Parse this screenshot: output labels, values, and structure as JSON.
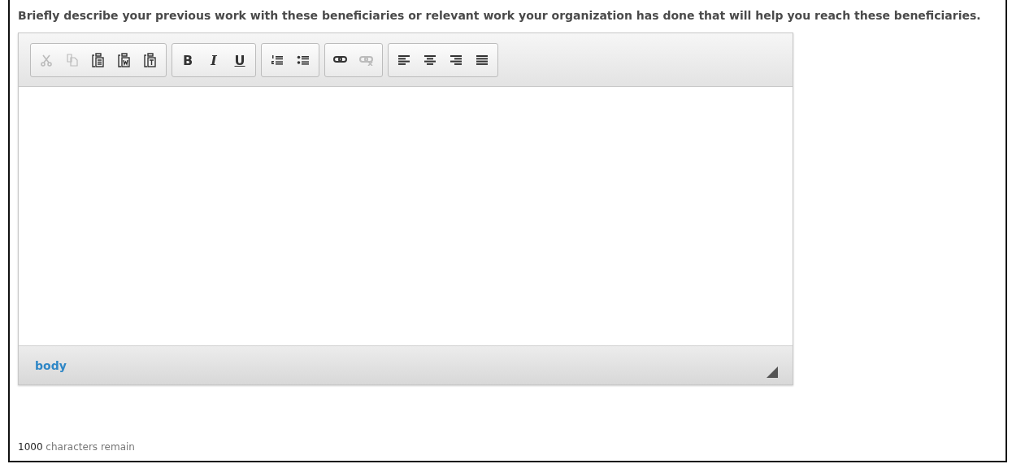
{
  "question": "Briefly describe your previous work with these beneficiaries or relevant work your organization has done that will help you reach these beneficiaries.",
  "toolbar": [
    {
      "items": [
        {
          "kind": "cut",
          "disabled": true
        },
        {
          "kind": "copy",
          "disabled": true
        },
        {
          "kind": "paste",
          "disabled": false
        },
        {
          "kind": "paste-word",
          "disabled": false
        },
        {
          "kind": "paste-text",
          "disabled": false
        }
      ]
    },
    {
      "items": [
        {
          "kind": "bold",
          "label": "B",
          "disabled": false
        },
        {
          "kind": "italic",
          "label": "I",
          "disabled": false
        },
        {
          "kind": "underline",
          "label": "U",
          "disabled": false
        }
      ]
    },
    {
      "items": [
        {
          "kind": "numbered-list",
          "disabled": false
        },
        {
          "kind": "bulleted-list",
          "disabled": false
        }
      ]
    },
    {
      "items": [
        {
          "kind": "link",
          "disabled": false
        },
        {
          "kind": "unlink",
          "disabled": true
        }
      ]
    },
    {
      "items": [
        {
          "kind": "align-left",
          "disabled": false
        },
        {
          "kind": "align-center",
          "disabled": false
        },
        {
          "kind": "align-right",
          "disabled": false
        },
        {
          "kind": "justify",
          "disabled": false
        }
      ]
    }
  ],
  "path": "body",
  "counter": {
    "count": "1000",
    "text": "characters remain"
  }
}
